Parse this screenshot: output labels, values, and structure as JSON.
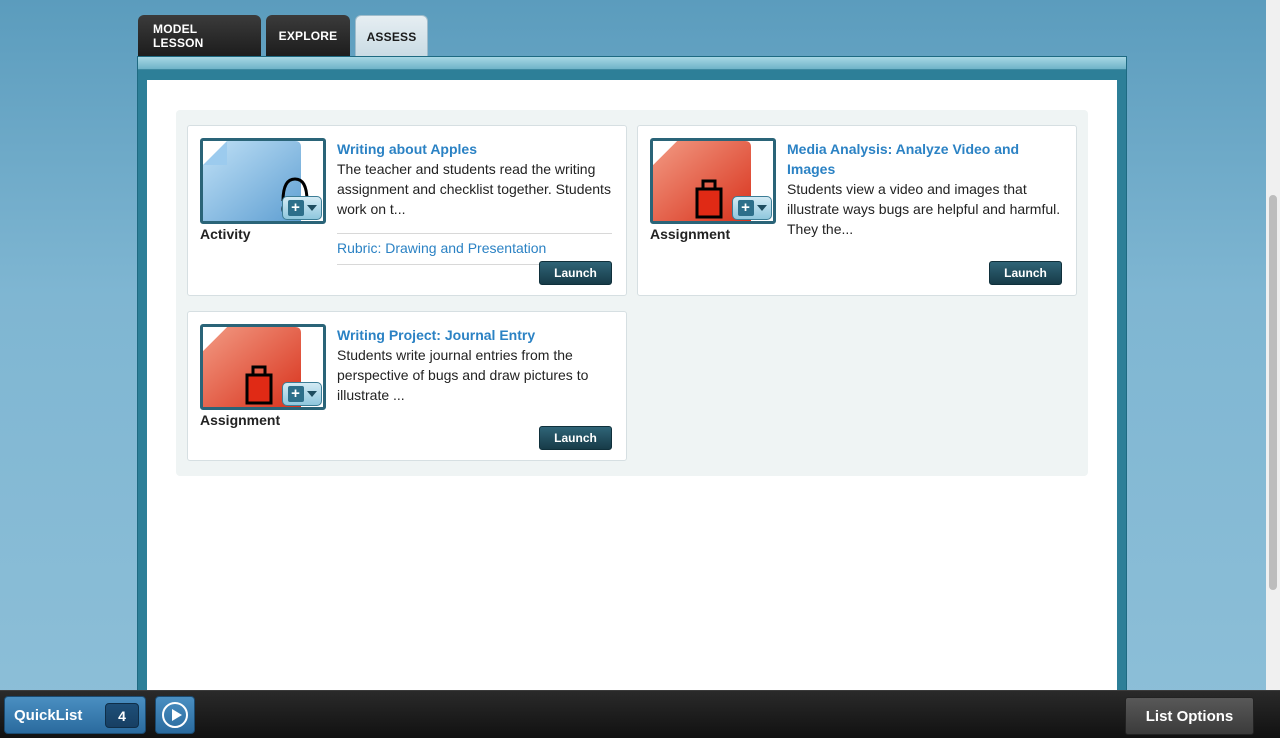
{
  "tabs": [
    {
      "label": "MODEL LESSON",
      "active": false
    },
    {
      "label": "EXPLORE",
      "active": false
    },
    {
      "label": "ASSESS",
      "active": true
    }
  ],
  "cards": [
    {
      "title": "Writing about Apples",
      "description": "The teacher and students read the writing assignment and checklist together. Students work on t...",
      "type": "Activity",
      "icon": "activity-doc-icon",
      "rubric": "Rubric: Drawing and Presentation",
      "launch_label": "Launch"
    },
    {
      "title": "Media Analysis: Analyze Video and Images",
      "description": "Students view a video and images that illustrate ways bugs are helpful and harmful. They the...",
      "type": "Assignment",
      "icon": "assignment-doc-icon",
      "launch_label": "Launch"
    },
    {
      "title": "Writing Project: Journal Entry",
      "description": "Students write journal entries from the perspective of bugs and draw pictures to illustrate ...",
      "type": "Assignment",
      "icon": "assignment-doc-icon",
      "launch_label": "Launch"
    }
  ],
  "bottombar": {
    "quicklist_label": "QuickList",
    "quicklist_count": "4",
    "list_options_label": "List Options"
  },
  "colors": {
    "link": "#2b82c4",
    "activity_blue": "#8fc0e6",
    "assignment_red": "#e9573f",
    "frame_teal": "#2d7f98"
  }
}
